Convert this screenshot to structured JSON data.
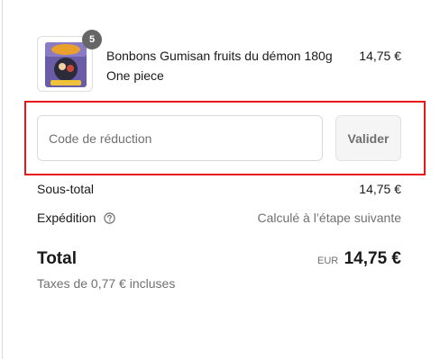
{
  "product": {
    "quantity": "5",
    "title": "Bonbons Gumisan fruits du démon 180g",
    "subtitle": "One piece",
    "price": "14,75 €",
    "image_icon": "candy-package-icon"
  },
  "discount": {
    "placeholder": "Code de réduction",
    "button_label": "Valider",
    "highlight_color": "#e8151b"
  },
  "summary": {
    "subtotal_label": "Sous-total",
    "subtotal_value": "14,75 €",
    "shipping_label": "Expédition",
    "shipping_value": "Calculé à l’étape suivante",
    "total_label": "Total",
    "currency": "EUR",
    "total_value": "14,75 €",
    "taxes": "Taxes de 0,77 € incluses"
  }
}
